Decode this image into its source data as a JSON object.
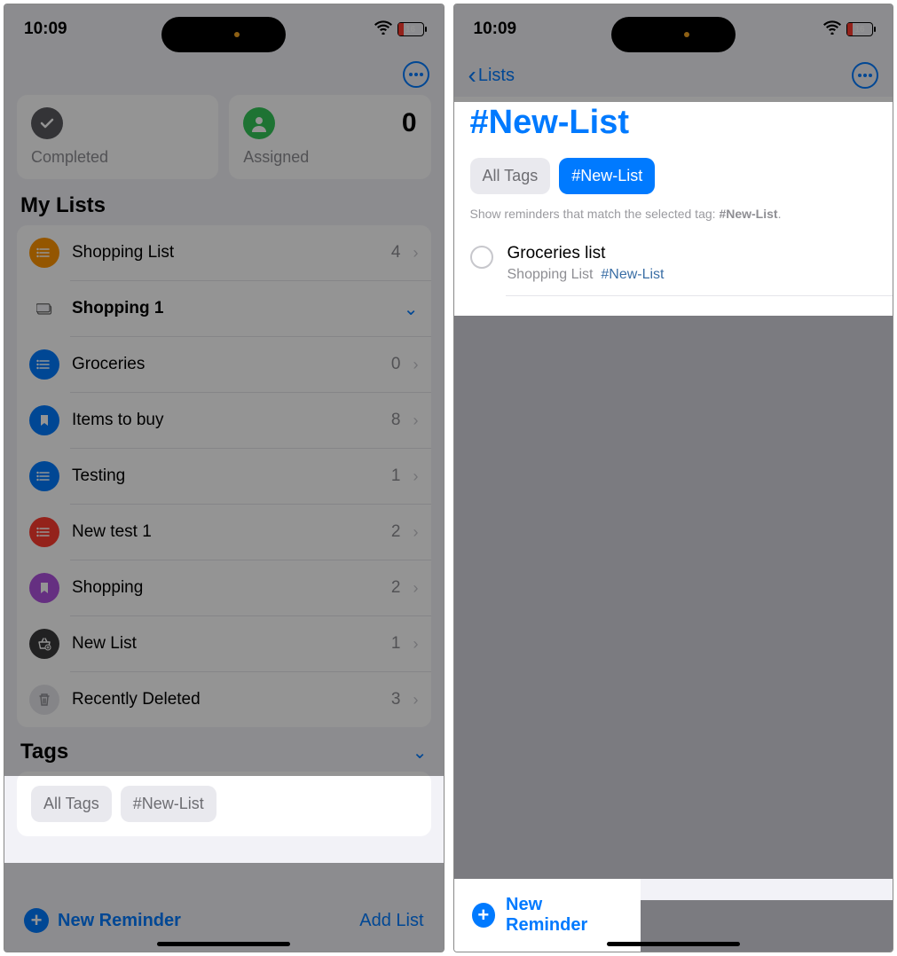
{
  "statusbar": {
    "time": "10:09",
    "battery": "16"
  },
  "left": {
    "cards": {
      "completed": {
        "label": "Completed"
      },
      "assigned": {
        "label": "Assigned",
        "count": "0"
      }
    },
    "my_lists_title": "My Lists",
    "lists": [
      {
        "name": "Shopping List",
        "count": "4",
        "icon": "list",
        "color": "#ff9500"
      },
      {
        "name": "Shopping 1",
        "count": "",
        "icon": "folder",
        "color": "#8e8e93",
        "isFolder": true
      },
      {
        "name": "Groceries",
        "count": "0",
        "icon": "list",
        "color": "#007aff"
      },
      {
        "name": "Items to buy",
        "count": "8",
        "icon": "bookmark",
        "color": "#007aff"
      },
      {
        "name": "Testing",
        "count": "1",
        "icon": "list",
        "color": "#007aff"
      },
      {
        "name": "New test 1",
        "count": "2",
        "icon": "list",
        "color": "#ff3b30"
      },
      {
        "name": "Shopping",
        "count": "2",
        "icon": "bookmark",
        "color": "#af52de"
      },
      {
        "name": "New List",
        "count": "1",
        "icon": "basket",
        "color": "#3a3a3c"
      },
      {
        "name": "Recently Deleted",
        "count": "3",
        "icon": "trash",
        "color": "#d1d1d6"
      }
    ],
    "tags_title": "Tags",
    "tags": {
      "all": "All Tags",
      "new_list": "#New-List"
    },
    "toolbar": {
      "new_reminder": "New Reminder",
      "add_list": "Add List"
    }
  },
  "right": {
    "back_label": "Lists",
    "title": "#New-List",
    "tags": {
      "all": "All Tags",
      "new_list": "#New-List"
    },
    "help_text": "Show reminders that match the selected tag: ",
    "help_tag": "#New-List",
    "reminder": {
      "title": "Groceries list",
      "list": "Shopping List",
      "tag": "#New-List"
    },
    "new_reminder": "New Reminder"
  }
}
